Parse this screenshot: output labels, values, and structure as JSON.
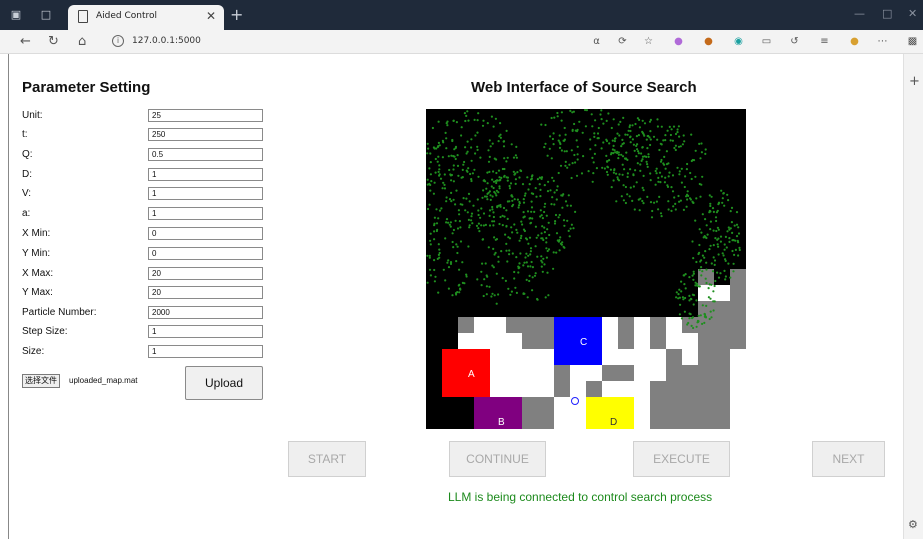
{
  "browser": {
    "tab_title": "Aided Control",
    "url": "127.0.0.1:5000",
    "icons": [
      "tab-actions-icon",
      "page-icon",
      "close-icon",
      "plus-icon",
      "back-icon",
      "refresh-icon",
      "home-icon",
      "info-icon",
      "read-aloud-icon",
      "extension-icon",
      "favorite-icon",
      "collections-icon",
      "profile-icon",
      "more-icon",
      "settings-icon"
    ]
  },
  "params": {
    "title": "Parameter Setting",
    "rows": [
      {
        "label": "Unit:",
        "value": "25"
      },
      {
        "label": "t:",
        "value": "250"
      },
      {
        "label": "Q:",
        "value": "0.5"
      },
      {
        "label": "D:",
        "value": "1"
      },
      {
        "label": "V:",
        "value": "1"
      },
      {
        "label": "a:",
        "value": "1"
      },
      {
        "label": "X Min:",
        "value": "0"
      },
      {
        "label": "Y Min:",
        "value": "0"
      },
      {
        "label": "X Max:",
        "value": "20"
      },
      {
        "label": "Y Max:",
        "value": "20"
      },
      {
        "label": "Particle Number:",
        "value": "2000"
      },
      {
        "label": "Step Size:",
        "value": "1"
      },
      {
        "label": "Size:",
        "value": "1"
      }
    ],
    "choose_file": "选择文件",
    "file_name": "uploaded_map.mat",
    "upload": "Upload"
  },
  "main": {
    "title": "Web Interface of Source Search",
    "map": {
      "labels": [
        "A",
        "B",
        "C",
        "D"
      ],
      "colors": {
        "A": "#ff0000",
        "B": "#800080",
        "C": "#0000ff",
        "D": "#ffff00",
        "obstacle": "#808080",
        "free": "#ffffff",
        "unknown": "#000000",
        "particle": "#1f8f1f"
      }
    },
    "buttons": {
      "start": "START",
      "continue": "CONTINUE",
      "execute": "EXECUTE",
      "next": "NEXT"
    },
    "status": "LLM is being connected to control search process"
  }
}
